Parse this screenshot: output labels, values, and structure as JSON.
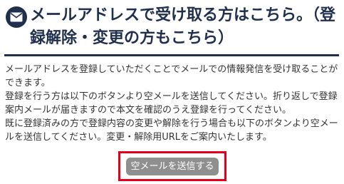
{
  "header": {
    "icon": "envelope-icon",
    "title": "メールアドレスで受け取る方はこちら。（登録解除・変更の方もこちら）"
  },
  "description": "メールアドレスを登録していただくことでメールでの情報発信を受け取ることができます。\n登録を行う方は以下のボタンより空メールを送信してください。折り返しで登録案内メールが届きますので本文を確認のうえ登録を行ってください。\n既に登録済みの方で登録内容の変更や解除を行う場合も以下のボタンより空メールを送信してください。変更・解除用URLをご案内いたします。",
  "button": {
    "label": "空メールを送信する"
  },
  "colors": {
    "title": "#1f2f4c",
    "highlight_border": "#e3001b",
    "button_bg": "#8f8f8f"
  }
}
